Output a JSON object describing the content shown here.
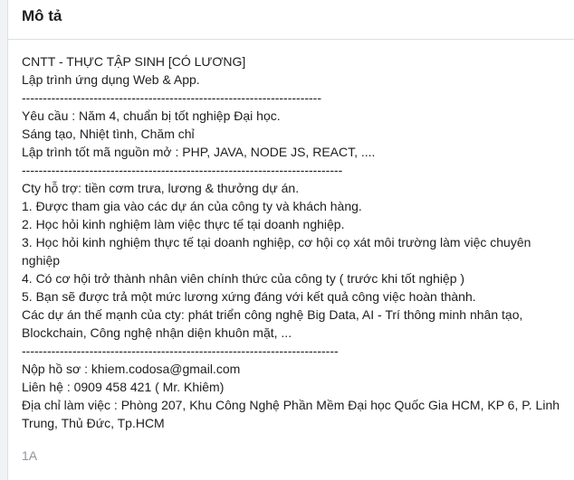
{
  "header": {
    "title": "Mô tả"
  },
  "description": {
    "lines": [
      "CNTT - THỰC TẬP SINH [CÓ LƯƠNG]",
      "Lập trình ứng dụng Web & App.",
      "-----------------------------------------------------------------------",
      "Yêu cầu : Năm 4, chuẩn bị tốt nghiệp Đại học.",
      "Sáng tạo, Nhiệt tình, Chăm chỉ",
      "Lập trình tốt mã nguồn mở : PHP, JAVA, NODE JS, REACT, ....",
      "----------------------------------------------------------------------------",
      "Cty hỗ trợ: tiền cơm trưa, lương & thưởng dự án.",
      "1. Được tham gia vào các dự án của công ty và khách hàng.",
      "2. Học hỏi kinh nghiệm làm việc thực tế tại doanh nghiệp.",
      "3. Học hỏi kinh nghiệm thực tế tại doanh nghiệp, cơ hội cọ xát môi trường làm việc chuyên nghiệp",
      "4. Có cơ hội trở thành nhân viên chính thức của công ty ( trước khi tốt nghiệp )",
      "5. Bạn sẽ được trả một mức lương xứng đáng với kết quả công việc hoàn thành.",
      "Các dự án thế mạnh của cty: phát triển công nghệ Big Data, AI - Trí thông minh nhân tạo, Blockchain, Công nghệ nhận diện khuôn mặt, ...",
      "---------------------------------------------------------------------------",
      "Nộp hồ sơ : khiem.codosa@gmail.com",
      "Liên hệ : 0909 458 421 ( Mr. Khiêm)",
      "Địa chỉ làm việc : Phòng 207, Khu Công Nghệ Phần Mềm Đại học Quốc Gia HCM, KP 6, P. Linh Trung, Thủ Đức, Tp.HCM"
    ]
  },
  "footer": {
    "tag": "1A"
  }
}
